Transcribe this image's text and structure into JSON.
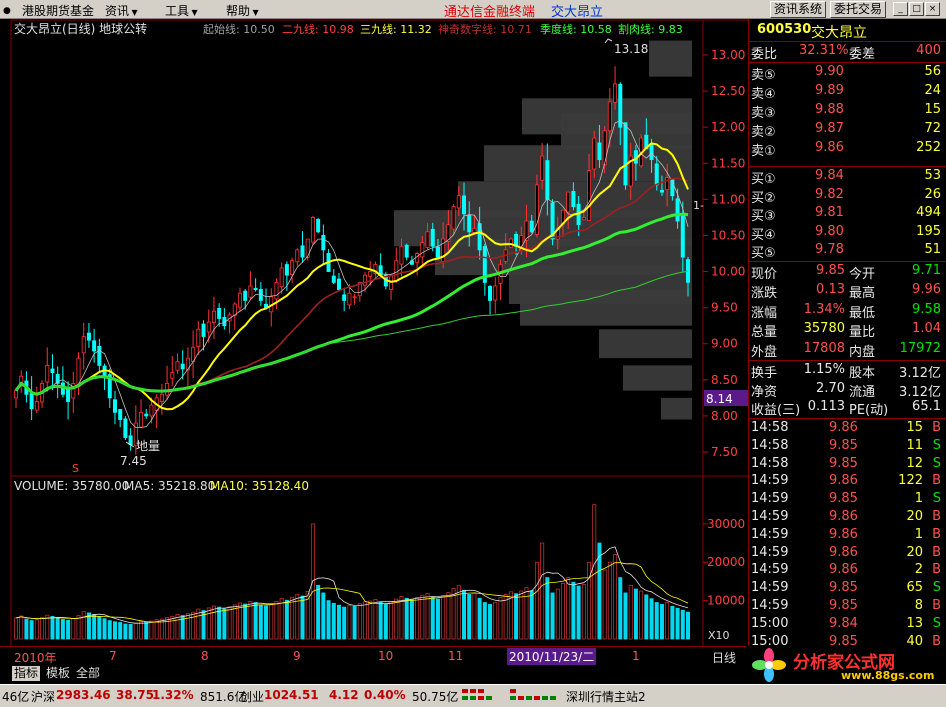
{
  "menu": {
    "items": [
      "港股期货基金",
      "资讯",
      "工具",
      "帮助"
    ],
    "app_title": "通达信金融终端",
    "stock_title": "交大昂立",
    "btn_info": "资讯系统",
    "btn_trade": "委托交易"
  },
  "window_buttons": [
    "_",
    "□",
    "×"
  ],
  "chart_header": {
    "name": "交大昂立(日线) 地球公转",
    "lines": [
      {
        "text": "起始线: 10.50",
        "color": "#a0a0a0"
      },
      {
        "text": "二九线: 10.98",
        "color": "#ff4040"
      },
      {
        "text": "三九线: 11.32",
        "color": "#ffff40"
      },
      {
        "text": "神奇数字线: 10.71",
        "color": "#c03030"
      },
      {
        "text": "季度线: 10.58",
        "color": "#40ff40"
      },
      {
        "text": "割肉线: 9.83",
        "color": "#40ff40"
      }
    ]
  },
  "price_axis": [
    "13.00",
    "12.50",
    "12.00",
    "11.50",
    "11.00",
    "10.50",
    "10.00",
    "9.50",
    "9.00",
    "8.50",
    "8.00",
    "7.50"
  ],
  "price_marker": "8.14",
  "price_marker_right": "1-",
  "annotations": {
    "high": "13.18",
    "low": "7.45",
    "label": "地量",
    "s_mark": "S"
  },
  "volume_header": {
    "vol": "VOLUME: 35780.00",
    "ma5": "MA5: 35218.80",
    "ma10": "MA10: 35128.40"
  },
  "volume_axis": [
    "30000",
    "20000",
    "10000"
  ],
  "volume_unit": "X10",
  "date_axis": {
    "labels": [
      "2010年",
      "7",
      "8",
      "9",
      "10",
      "11",
      "1"
    ],
    "highlight": "2010/11/23/二",
    "period": "日线"
  },
  "tabs": [
    "指标",
    "模板",
    "全部"
  ],
  "status": {
    "left": "46亿",
    "index": "沪深",
    "index_val": "2983.46",
    "chg": "38.75",
    "pct": "1.32%",
    "amount": "851.6亿",
    "cy": "创业",
    "cy_val": "1024.51",
    "cy_chg": "4.12",
    "cy_pct": "0.40%",
    "cy_amt": "50.75亿",
    "server": "深圳行情主站2"
  },
  "colors": {
    "up": "#ff3232",
    "down": "#00ffff",
    "bg": "#000000",
    "border": "#800000",
    "yellow": "#ffff00"
  },
  "quote": {
    "code": "600530",
    "name": "交大昂立",
    "wb_label": "委比",
    "wb": "32.31%",
    "wc_label": "委差",
    "wc": "400",
    "asks": [
      {
        "label": "卖⑤",
        "price": "9.90",
        "vol": "56"
      },
      {
        "label": "卖④",
        "price": "9.89",
        "vol": "24"
      },
      {
        "label": "卖③",
        "price": "9.88",
        "vol": "15"
      },
      {
        "label": "卖②",
        "price": "9.87",
        "vol": "72"
      },
      {
        "label": "卖①",
        "price": "9.86",
        "vol": "252"
      }
    ],
    "bids": [
      {
        "label": "买①",
        "price": "9.84",
        "vol": "53"
      },
      {
        "label": "买②",
        "price": "9.82",
        "vol": "26"
      },
      {
        "label": "买③",
        "price": "9.81",
        "vol": "494"
      },
      {
        "label": "买④",
        "price": "9.80",
        "vol": "195"
      },
      {
        "label": "买⑤",
        "price": "9.78",
        "vol": "51"
      }
    ],
    "stats": [
      [
        {
          "l": "现价",
          "v": "9.85",
          "c": "red"
        },
        {
          "l": "今开",
          "v": "9.71",
          "c": "grn"
        }
      ],
      [
        {
          "l": "涨跌",
          "v": "0.13",
          "c": "red"
        },
        {
          "l": "最高",
          "v": "9.96",
          "c": "red"
        }
      ],
      [
        {
          "l": "涨幅",
          "v": "1.34%",
          "c": "red"
        },
        {
          "l": "最低",
          "v": "9.58",
          "c": "grn"
        }
      ],
      [
        {
          "l": "总量",
          "v": "35780",
          "c": "yel"
        },
        {
          "l": "量比",
          "v": "1.04",
          "c": "red"
        }
      ],
      [
        {
          "l": "外盘",
          "v": "17808",
          "c": "red"
        },
        {
          "l": "内盘",
          "v": "17972",
          "c": "grn"
        }
      ]
    ],
    "stats2": [
      [
        {
          "l": "换手",
          "v": "1.15%",
          "c": "wht"
        },
        {
          "l": "股本",
          "v": "3.12亿",
          "c": "wht"
        }
      ],
      [
        {
          "l": "净资",
          "v": "2.70",
          "c": "wht"
        },
        {
          "l": "流通",
          "v": "3.12亿",
          "c": "wht"
        }
      ],
      [
        {
          "l": "收益(三)",
          "v": "0.113",
          "c": "wht"
        },
        {
          "l": "PE(动)",
          "v": "65.1",
          "c": "wht"
        }
      ]
    ],
    "ticks": [
      {
        "t": "14:58",
        "p": "9.86",
        "v": "15",
        "d": "B"
      },
      {
        "t": "14:58",
        "p": "9.85",
        "v": "11",
        "d": "S"
      },
      {
        "t": "14:58",
        "p": "9.85",
        "v": "12",
        "d": "S"
      },
      {
        "t": "14:59",
        "p": "9.86",
        "v": "122",
        "d": "B"
      },
      {
        "t": "14:59",
        "p": "9.85",
        "v": "1",
        "d": "S"
      },
      {
        "t": "14:59",
        "p": "9.86",
        "v": "20",
        "d": "B"
      },
      {
        "t": "14:59",
        "p": "9.86",
        "v": "1",
        "d": "B"
      },
      {
        "t": "14:59",
        "p": "9.86",
        "v": "20",
        "d": "B"
      },
      {
        "t": "14:59",
        "p": "9.86",
        "v": "2",
        "d": "B"
      },
      {
        "t": "14:59",
        "p": "9.85",
        "v": "65",
        "d": "S"
      },
      {
        "t": "14:59",
        "p": "9.85",
        "v": "8",
        "d": "B"
      },
      {
        "t": "15:00",
        "p": "9.84",
        "v": "13",
        "d": "S"
      },
      {
        "t": "15:00",
        "p": "9.85",
        "v": "40",
        "d": "B"
      }
    ]
  },
  "logo": {
    "text": "分析家公式网",
    "url": "www.88gs.com"
  },
  "chart_data": {
    "type": "candlestick",
    "ylim": [
      7.2,
      13.3
    ],
    "n": 130,
    "close": [
      8.35,
      8.55,
      8.3,
      8.1,
      8.2,
      8.45,
      8.7,
      8.6,
      8.45,
      8.3,
      8.2,
      8.45,
      8.8,
      9.1,
      9.05,
      8.9,
      8.7,
      8.55,
      8.25,
      8.05,
      7.95,
      7.7,
      7.6,
      7.9,
      8.05,
      8.0,
      8.15,
      8.25,
      8.3,
      8.45,
      8.6,
      8.75,
      8.65,
      8.8,
      8.95,
      9.2,
      9.1,
      9.3,
      9.45,
      9.35,
      9.25,
      9.4,
      9.55,
      9.7,
      9.6,
      9.8,
      9.75,
      9.6,
      9.5,
      9.65,
      9.85,
      10.05,
      9.95,
      10.15,
      10.3,
      10.2,
      10.45,
      10.75,
      10.55,
      10.3,
      10.0,
      9.85,
      9.75,
      9.6,
      9.7,
      9.65,
      9.85,
      9.95,
      10.0,
      10.1,
      9.95,
      9.8,
      9.95,
      10.15,
      10.35,
      10.2,
      10.1,
      10.25,
      10.4,
      10.55,
      10.35,
      10.2,
      10.45,
      10.65,
      10.9,
      11.05,
      10.8,
      10.55,
      10.6,
      10.3,
      9.85,
      9.6,
      9.8,
      10.1,
      10.3,
      10.45,
      10.35,
      10.5,
      10.7,
      10.55,
      11.2,
      11.6,
      11.0,
      10.45,
      10.6,
      10.85,
      11.1,
      10.9,
      10.65,
      10.75,
      11.4,
      11.85,
      11.55,
      11.95,
      12.35,
      12.6,
      12.0,
      11.2,
      11.6,
      11.5,
      11.85,
      11.7,
      11.55,
      11.2,
      11.1,
      11.3,
      11.05,
      10.7,
      10.2,
      9.85
    ],
    "volume": [
      5500,
      6000,
      5200,
      4800,
      5000,
      5600,
      6200,
      5900,
      5400,
      5100,
      4900,
      5300,
      6100,
      7200,
      6800,
      6400,
      5800,
      5300,
      4800,
      4500,
      4300,
      3900,
      3800,
      4100,
      4500,
      4400,
      4700,
      5000,
      5200,
      5600,
      5900,
      6400,
      6100,
      6600,
      7000,
      7800,
      7400,
      8100,
      8600,
      8300,
      7900,
      8400,
      8900,
      9400,
      9100,
      9800,
      9500,
      8900,
      8600,
      9000,
      9800,
      10600,
      10100,
      10900,
      11600,
      11200,
      12400,
      30000,
      14000,
      12000,
      10000,
      9300,
      8800,
      8300,
      8700,
      8500,
      9200,
      9700,
      9900,
      10300,
      9600,
      9100,
      9700,
      10400,
      11100,
      10600,
      10200,
      10800,
      11400,
      11900,
      11000,
      10400,
      11300,
      12100,
      13200,
      13900,
      12700,
      11600,
      11900,
      10600,
      9500,
      9000,
      9600,
      10800,
      11600,
      12300,
      11800,
      12500,
      13400,
      12600,
      20000,
      25000,
      16000,
      12000,
      13000,
      14500,
      16000,
      14800,
      13800,
      14200,
      20000,
      35000,
      25000,
      18000,
      20000,
      22000,
      16000,
      12000,
      14000,
      13000,
      12500,
      11500,
      10500,
      9500,
      9000,
      9500,
      8500,
      8000,
      7500,
      7000
    ]
  }
}
